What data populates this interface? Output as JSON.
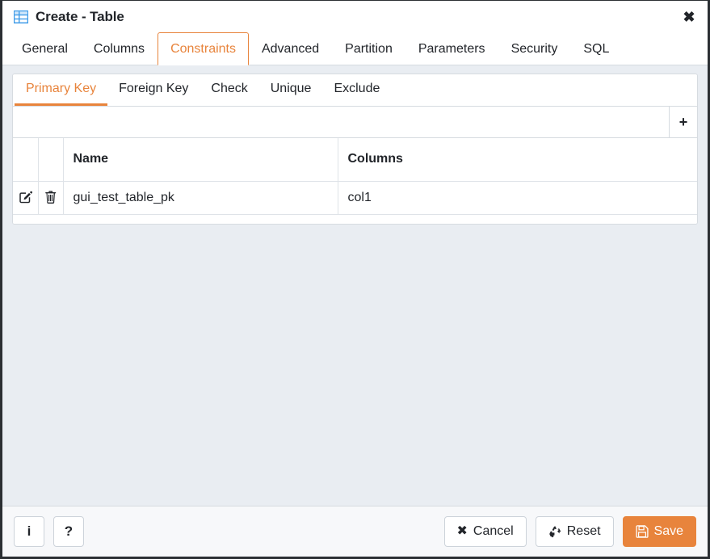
{
  "window": {
    "title": "Create - Table",
    "title_icon": "table-icon",
    "close_icon": "close-icon"
  },
  "tabs": [
    {
      "label": "General",
      "active": false
    },
    {
      "label": "Columns",
      "active": false
    },
    {
      "label": "Constraints",
      "active": true
    },
    {
      "label": "Advanced",
      "active": false
    },
    {
      "label": "Partition",
      "active": false
    },
    {
      "label": "Parameters",
      "active": false
    },
    {
      "label": "Security",
      "active": false
    },
    {
      "label": "SQL",
      "active": false
    }
  ],
  "subtabs": [
    {
      "label": "Primary Key",
      "active": true
    },
    {
      "label": "Foreign Key",
      "active": false
    },
    {
      "label": "Check",
      "active": false
    },
    {
      "label": "Unique",
      "active": false
    },
    {
      "label": "Exclude",
      "active": false
    }
  ],
  "toolbar": {
    "add_label": "+",
    "add_icon": "plus-icon"
  },
  "grid": {
    "headers": [
      "",
      "",
      "Name",
      "Columns"
    ],
    "rows": [
      {
        "edit_icon": "edit-icon",
        "delete_icon": "trash-icon",
        "name": "gui_test_table_pk",
        "columns": "col1"
      }
    ]
  },
  "footer": {
    "info_label": "i",
    "help_label": "?",
    "cancel_label": "Cancel",
    "reset_label": "Reset",
    "save_label": "Save"
  },
  "colors": {
    "accent": "#e8843c",
    "body_background": "#e9edf2",
    "panel_background": "#ffffff",
    "border": "#d6dbe0",
    "text": "#22252a"
  }
}
